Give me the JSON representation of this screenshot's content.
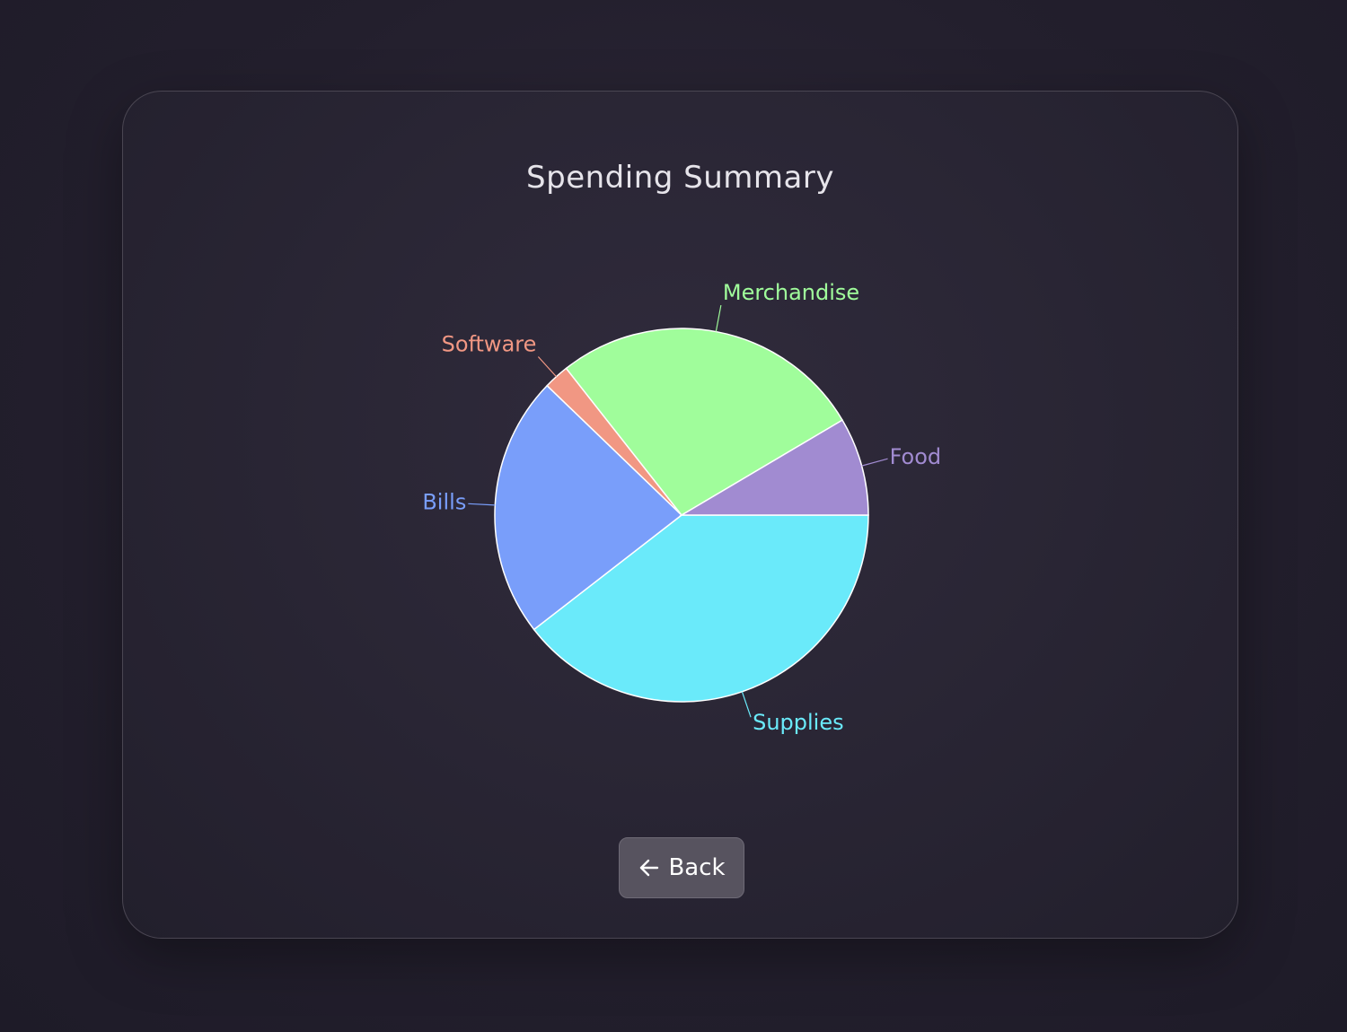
{
  "back_button": {
    "label": "Back",
    "icon": "arrow-left-icon"
  },
  "chart_data": {
    "type": "pie",
    "title": "Spending Summary",
    "slices": [
      {
        "label": "Supplies",
        "value": 39.5,
        "color": "#6aeafa"
      },
      {
        "label": "Bills",
        "value": 22.7,
        "color": "#799efa"
      },
      {
        "label": "Software",
        "value": 2.2,
        "color": "#f19783"
      },
      {
        "label": "Merchandise",
        "value": 27.1,
        "color": "#a0fd9b"
      },
      {
        "label": "Food",
        "value": 8.5,
        "color": "#a18bd1"
      }
    ],
    "start_angle_deg": 0,
    "direction": "clockwise",
    "slice_border_color": "#ffffff"
  },
  "colors": {
    "background": "#231f2d",
    "card_border": "#4a4652",
    "title_text": "#e6e4ea",
    "button_background": "#57535f"
  }
}
